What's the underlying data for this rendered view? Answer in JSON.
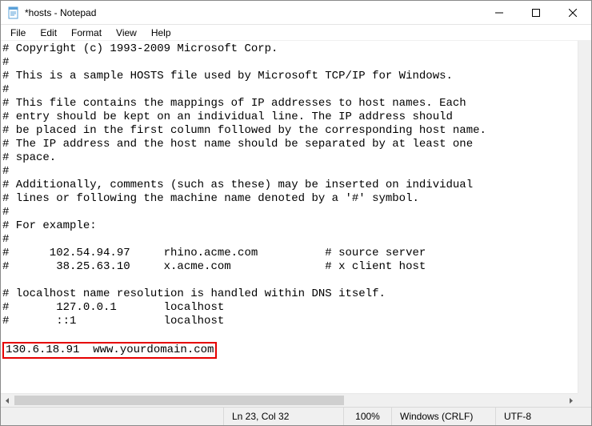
{
  "window": {
    "title": "*hosts - Notepad"
  },
  "menu": {
    "file": "File",
    "edit": "Edit",
    "format": "Format",
    "view": "View",
    "help": "Help"
  },
  "content": {
    "lines": [
      "# Copyright (c) 1993-2009 Microsoft Corp.",
      "#",
      "# This is a sample HOSTS file used by Microsoft TCP/IP for Windows.",
      "#",
      "# This file contains the mappings of IP addresses to host names. Each",
      "# entry should be kept on an individual line. The IP address should",
      "# be placed in the first column followed by the corresponding host name.",
      "# The IP address and the host name should be separated by at least one",
      "# space.",
      "#",
      "# Additionally, comments (such as these) may be inserted on individual",
      "# lines or following the machine name denoted by a '#' symbol.",
      "#",
      "# For example:",
      "#",
      "#      102.54.94.97     rhino.acme.com          # source server",
      "#       38.25.63.10     x.acme.com              # x client host",
      "",
      "# localhost name resolution is handled within DNS itself.",
      "#       127.0.0.1       localhost",
      "#       ::1             localhost",
      ""
    ],
    "highlighted_line": "130.6.18.91  www.yourdomain.com"
  },
  "status": {
    "position": "Ln 23, Col 32",
    "zoom": "100%",
    "eol": "Windows (CRLF)",
    "encoding": "UTF-8"
  }
}
